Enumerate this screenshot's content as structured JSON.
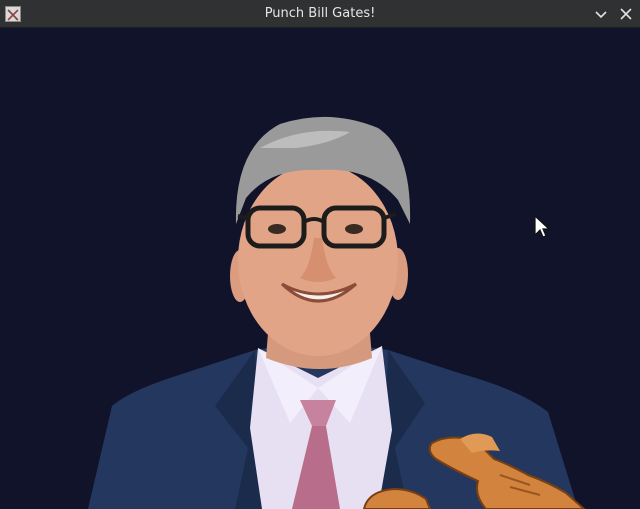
{
  "window": {
    "title": "Punch Bill Gates!",
    "icons": {
      "app": "x-app-icon",
      "minimize": "chevron-down-icon",
      "close": "close-icon"
    }
  },
  "colors": {
    "background": "#10132a",
    "titlebar": "#2f3133",
    "title_text": "#e6e6e6",
    "suit": "#24385f",
    "shirt": "#e6e0f2",
    "tie": "#c7839d",
    "hair": "#9a9a9a",
    "skin": "#e2a486",
    "hand": "#d2843e"
  }
}
